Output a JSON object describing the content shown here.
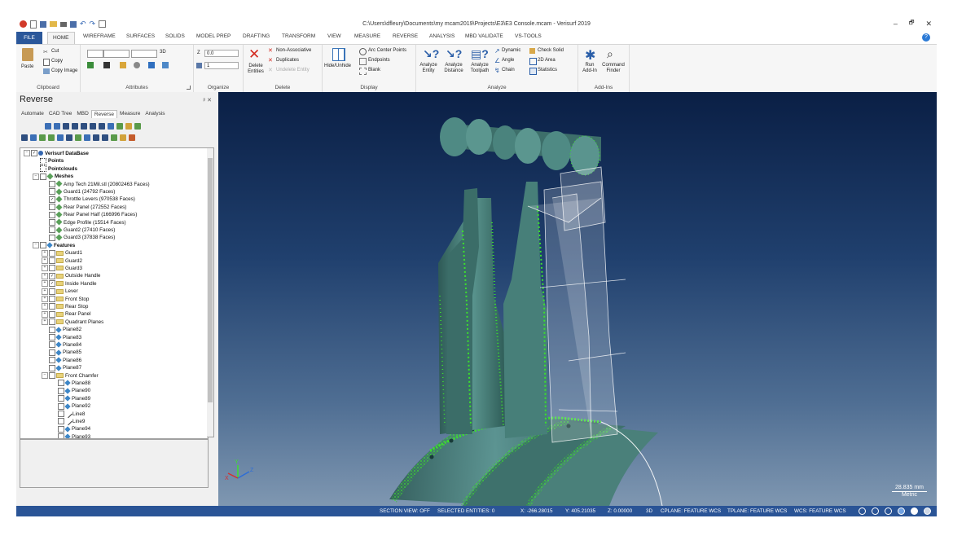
{
  "window": {
    "title": "C:\\Users\\dfleury\\Documents\\my mcam2019\\Projects\\E3\\E3 Console.mcam - Verisurf 2019",
    "controls": [
      "–",
      "🗗",
      "✕"
    ]
  },
  "ribbon_tabs": [
    "FILE",
    "HOME",
    "WIREFRAME",
    "SURFACES",
    "SOLIDS",
    "MODEL PREP",
    "DRAFTING",
    "TRANSFORM",
    "VIEW",
    "MEASURE",
    "REVERSE",
    "ANALYSIS",
    "MBD VALIDATE",
    "VS-TOOLS"
  ],
  "ribbon": {
    "clipboard": {
      "label": "Clipboard",
      "paste": "Paste",
      "cut": "Cut",
      "copy": "Copy",
      "copy_image": "Copy Image"
    },
    "attributes": {
      "label": "Attributes",
      "mode": "3D"
    },
    "organize": {
      "label": "Organize",
      "z_label": "Z",
      "z_value": "0.0",
      "level_value": "1"
    },
    "delete": {
      "label": "Delete",
      "delete_entities": "Delete Entities",
      "non_associative": "Non-Associative",
      "duplicates": "Duplicates",
      "undelete": "Undelete Entity"
    },
    "display": {
      "label": "Display",
      "hide_unhide": "Hide/Unhide",
      "arc_center": "Arc Center Points",
      "endpoints": "Endpoints",
      "blank": "Blank"
    },
    "analyze": {
      "label": "Analyze",
      "analyze_entity": "Analyze Entity",
      "analyze_distance": "Analyze Distance",
      "analyze_toolpath": "Analyze Toolpath",
      "dynamic": "Dynamic",
      "angle": "Angle",
      "chain": "Chain",
      "check_solid": "Check Solid",
      "area_2d": "2D Area",
      "statistics": "Statistics"
    },
    "addins": {
      "label": "Add-Ins",
      "run_addin": "Run Add-In",
      "command_finder": "Command Finder"
    }
  },
  "panel": {
    "title": "Reverse",
    "pin": "ᵖ ✕",
    "tabs": [
      "Automate",
      "CAD Tree",
      "MBD",
      "Reverse",
      "Measure",
      "Analysis"
    ],
    "tree": [
      {
        "label": "Verisurf DataBase",
        "indent": 0,
        "icon": "database",
        "bold": true,
        "exp": "−",
        "cb": "✓"
      },
      {
        "label": "Points",
        "indent": 1,
        "icon": "points",
        "bold": true
      },
      {
        "label": "Pointclouds",
        "indent": 1,
        "icon": "pointcloud",
        "bold": true
      },
      {
        "label": "Meshes",
        "indent": 1,
        "icon": "mesh",
        "bold": true,
        "exp": "−",
        "cb": ""
      },
      {
        "label": "Amp Tech 21Mil.stl (20802463 Faces)",
        "indent": 2,
        "icon": "mesh",
        "cb": ""
      },
      {
        "label": "Guard1 (24792 Faces)",
        "indent": 2,
        "icon": "mesh",
        "cb": ""
      },
      {
        "label": "Throttle Levers (970538 Faces)",
        "indent": 2,
        "icon": "mesh",
        "cb": "✓"
      },
      {
        "label": "Rear Panel (272552 Faces)",
        "indent": 2,
        "icon": "mesh",
        "cb": ""
      },
      {
        "label": "Rear Panel Half (166996 Faces)",
        "indent": 2,
        "icon": "mesh",
        "cb": ""
      },
      {
        "label": "Edge Profile (15514 Faces)",
        "indent": 2,
        "icon": "mesh",
        "cb": ""
      },
      {
        "label": "Guard2 (27410 Faces)",
        "indent": 2,
        "icon": "mesh",
        "cb": ""
      },
      {
        "label": "Guard3 (37838 Faces)",
        "indent": 2,
        "icon": "mesh",
        "cb": ""
      },
      {
        "label": "Features",
        "indent": 1,
        "icon": "features",
        "bold": true,
        "exp": "−",
        "cb": ""
      },
      {
        "label": "Guard1",
        "indent": 2,
        "icon": "folder",
        "exp": "+",
        "cb": ""
      },
      {
        "label": "Guard2",
        "indent": 2,
        "icon": "folder",
        "exp": "+",
        "cb": ""
      },
      {
        "label": "Guard3",
        "indent": 2,
        "icon": "folder",
        "exp": "+",
        "cb": ""
      },
      {
        "label": "Outside Handle",
        "indent": 2,
        "icon": "folder",
        "exp": "+",
        "cb": "✓"
      },
      {
        "label": "Inside Handle",
        "indent": 2,
        "icon": "folder",
        "exp": "+",
        "cb": "✓"
      },
      {
        "label": "Lever",
        "indent": 2,
        "icon": "folder",
        "exp": "+",
        "cb": ""
      },
      {
        "label": "Front Stop",
        "indent": 2,
        "icon": "folder",
        "exp": "+",
        "cb": ""
      },
      {
        "label": "Rear Stop",
        "indent": 2,
        "icon": "folder",
        "exp": "+",
        "cb": ""
      },
      {
        "label": "Rear Panel",
        "indent": 2,
        "icon": "folder",
        "exp": "+",
        "cb": ""
      },
      {
        "label": "Quadrant Planes",
        "indent": 2,
        "icon": "folder",
        "exp": "+",
        "cb": ""
      },
      {
        "label": "Plane82",
        "indent": 2,
        "icon": "plane",
        "cb": ""
      },
      {
        "label": "Plane83",
        "indent": 2,
        "icon": "plane",
        "cb": ""
      },
      {
        "label": "Plane84",
        "indent": 2,
        "icon": "plane",
        "cb": ""
      },
      {
        "label": "Plane85",
        "indent": 2,
        "icon": "plane",
        "cb": ""
      },
      {
        "label": "Plane86",
        "indent": 2,
        "icon": "plane",
        "cb": ""
      },
      {
        "label": "Plane87",
        "indent": 2,
        "icon": "plane",
        "cb": ""
      },
      {
        "label": "Front Chamfer",
        "indent": 2,
        "icon": "folder",
        "exp": "−",
        "cb": ""
      },
      {
        "label": "Plane88",
        "indent": 3,
        "icon": "plane",
        "cb": ""
      },
      {
        "label": "Plane90",
        "indent": 3,
        "icon": "plane",
        "cb": ""
      },
      {
        "label": "Plane89",
        "indent": 3,
        "icon": "plane",
        "cb": ""
      },
      {
        "label": "Plane92",
        "indent": 3,
        "icon": "plane",
        "cb": ""
      },
      {
        "label": "Line8",
        "indent": 3,
        "icon": "line",
        "cb": ""
      },
      {
        "label": "Line9",
        "indent": 3,
        "icon": "line",
        "cb": ""
      },
      {
        "label": "Plane94",
        "indent": 3,
        "icon": "plane",
        "cb": ""
      },
      {
        "label": "Plane93",
        "indent": 3,
        "icon": "plane",
        "cb": ""
      }
    ]
  },
  "viewport": {
    "scale_value": "28.835 mm",
    "scale_unit": "Metric",
    "axis_x": "X",
    "axis_y": "Y",
    "axis_z": "Z"
  },
  "status": {
    "section_view": "SECTION VIEW: OFF",
    "selected": "SELECTED ENTITIES: 0",
    "x": "X:   -266.28015",
    "y": "Y:   405.21035",
    "z": "Z:   0.00000",
    "mode": "3D",
    "cplane": "CPLANE: FEATURE WCS",
    "tplane": "TPLANE: FEATURE WCS",
    "wcs": "WCS: FEATURE WCS"
  },
  "colors": {
    "accent": "#2b579a",
    "status_bar": "#2a5496",
    "model_teal": "#3f7670",
    "point_green": "#39e22a"
  }
}
